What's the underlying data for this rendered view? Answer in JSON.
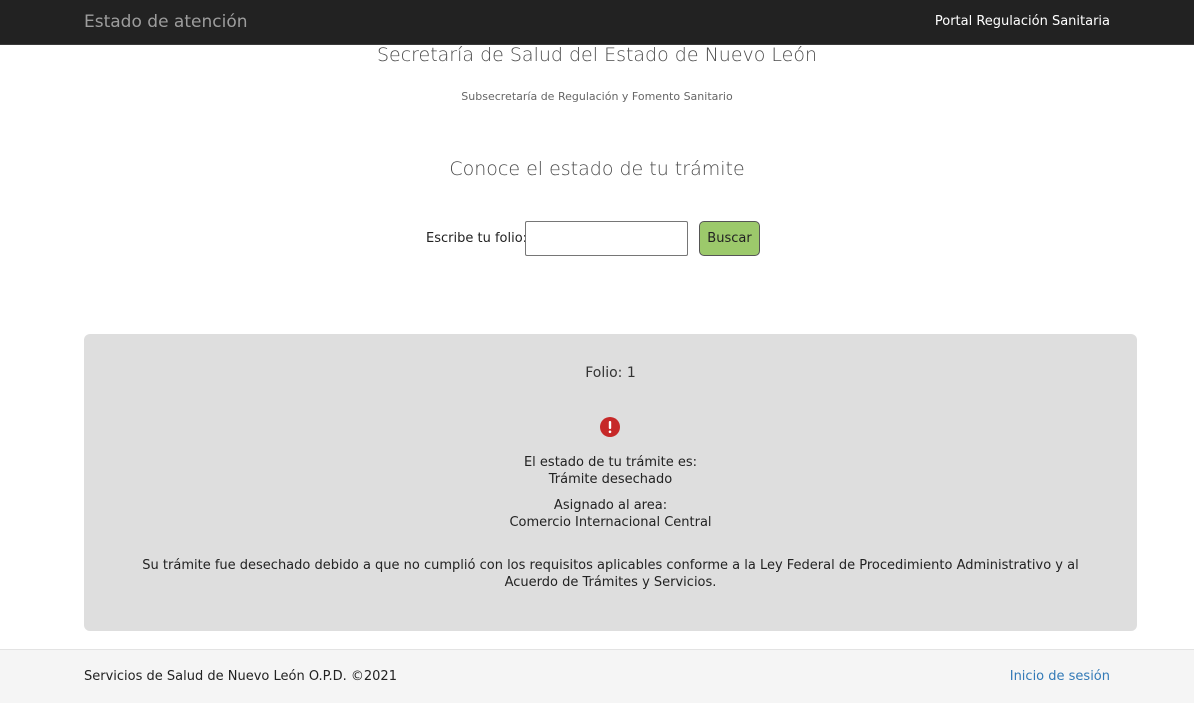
{
  "navbar": {
    "brand": "Estado de atención",
    "portal_link": "Portal Regulación Sanitaria"
  },
  "header": {
    "organization": "Secretaría de Salud del Estado de Nuevo León",
    "suborganization": "Subsecretaría de Regulación y Fomento Sanitario",
    "heading": "Conoce el estado de tu trámite"
  },
  "search": {
    "label": "Escribe tu folio:",
    "value": "",
    "button_label": "Buscar",
    "button_color": "#9cc96b"
  },
  "result": {
    "folio": "Folio: 1",
    "icon": "alert-circle-icon",
    "icon_color": "#c62828",
    "status_label": "El estado de tu trámite es:",
    "status_value": "Trámite desechado",
    "area_label": "Asignado al area:",
    "area_value": "Comercio Internacional Central",
    "message": "Su trámite fue desechado debido a que no cumplió con los requisitos aplicables conforme a la Ley Federal de Procedimiento Administrativo y al Acuerdo de Trámites y Servicios."
  },
  "footer": {
    "copyright": "Servicios de Salud de Nuevo León O.P.D. ©2021",
    "login_link": "Inicio de sesión",
    "link_color": "#337ab7"
  }
}
